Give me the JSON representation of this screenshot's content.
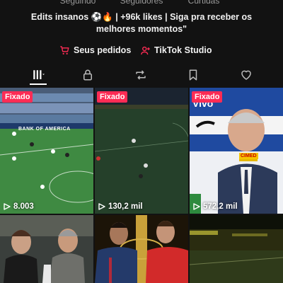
{
  "stats": {
    "following_label": "Seguindo",
    "followers_label": "Seguidores",
    "likes_label": "Curtidas"
  },
  "bio": {
    "line1": "Edits insanos ⚽🔥 | +96k likes | Siga pra receber os",
    "line2": "melhores momentos\""
  },
  "links": {
    "orders": "Seus pedidos",
    "studio": "TikTok Studio"
  },
  "tabs": [
    "videos-grid",
    "private",
    "reposts",
    "favorites",
    "liked"
  ],
  "accent": "#fe2c55",
  "videos": [
    {
      "pinned": "Fixado",
      "views": "8.003",
      "overlay": "BANK OF AMERICA"
    },
    {
      "pinned": "Fixado",
      "views": "130,2 mil"
    },
    {
      "pinned": "Fixado",
      "views": "572,2 mil",
      "overlay_brand": "Vivo",
      "overlay_tag": "CIMED"
    },
    {
      "pinned": "",
      "views": ""
    },
    {
      "pinned": "",
      "views": ""
    },
    {
      "pinned": "",
      "views": ""
    }
  ]
}
